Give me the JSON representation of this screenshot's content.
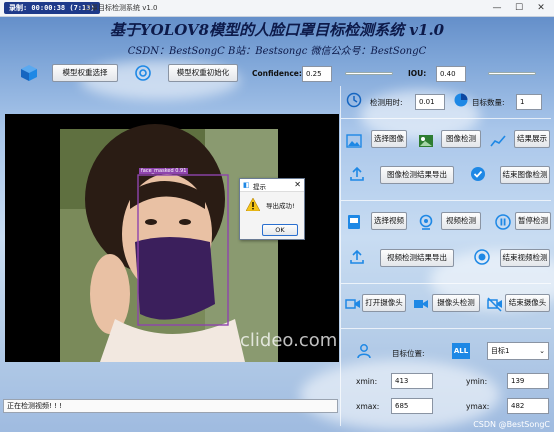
{
  "titlebar": {
    "timer": "录制: 00:00:38 (7:13)",
    "title": "口罩目标检测系统 v1.0",
    "minimize": "—",
    "maximize": "☐",
    "close": "✕"
  },
  "header": {
    "title": "基于YOLOV8模型的人脸口罩目标检测系统 v1.0",
    "subtitle": "CSDN：BestSongC   B站：Bestsongc   微信公众号：BestSongC"
  },
  "toolbar": {
    "select_weights": "模型权重选择",
    "init_weights": "模型权重初始化",
    "confidence_label": "Confidence:",
    "confidence_value": "0.25",
    "iou_label": "IOU:",
    "iou_value": "0.40"
  },
  "stats": {
    "time_label": "检测用时:",
    "time_value": "0.01",
    "count_label": "目标数量:",
    "count_value": "1"
  },
  "image_section": {
    "select_image": "选择图像",
    "detect_image": "图像检测",
    "show_result": "结果展示",
    "export_image": "图像检测结果导出",
    "end_image": "结束图像检测"
  },
  "video_section": {
    "select_video": "选择视频",
    "detect_video": "视频检测",
    "pause": "暂停检测",
    "export_video": "视频检测结果导出",
    "end_video": "结束视频检测"
  },
  "camera_section": {
    "open_camera": "打开摄像头",
    "detect_camera": "摄像头检测",
    "close_camera": "结束摄像头"
  },
  "target": {
    "label": "目标位置:",
    "all_badge": "ALL",
    "selected": "目标1",
    "xmin_label": "xmin:",
    "xmin": "413",
    "ymin_label": "ymin:",
    "ymin": "139",
    "xmax_label": "xmax:",
    "xmax": "685",
    "ymax_label": "ymax:",
    "ymax": "482"
  },
  "video": {
    "box_label": "face_masked 0.91",
    "watermark": "clideo.com"
  },
  "dialog": {
    "title": "提示",
    "message": "导出成功!",
    "ok": "OK"
  },
  "status": {
    "text": "正在检测视频! ! !"
  },
  "footer": {
    "credit": "CSDN @BestSongC"
  },
  "colors": {
    "accent": "#1e88e5",
    "detection_box": "#8e44ad",
    "mask": "#3b1f5c"
  }
}
